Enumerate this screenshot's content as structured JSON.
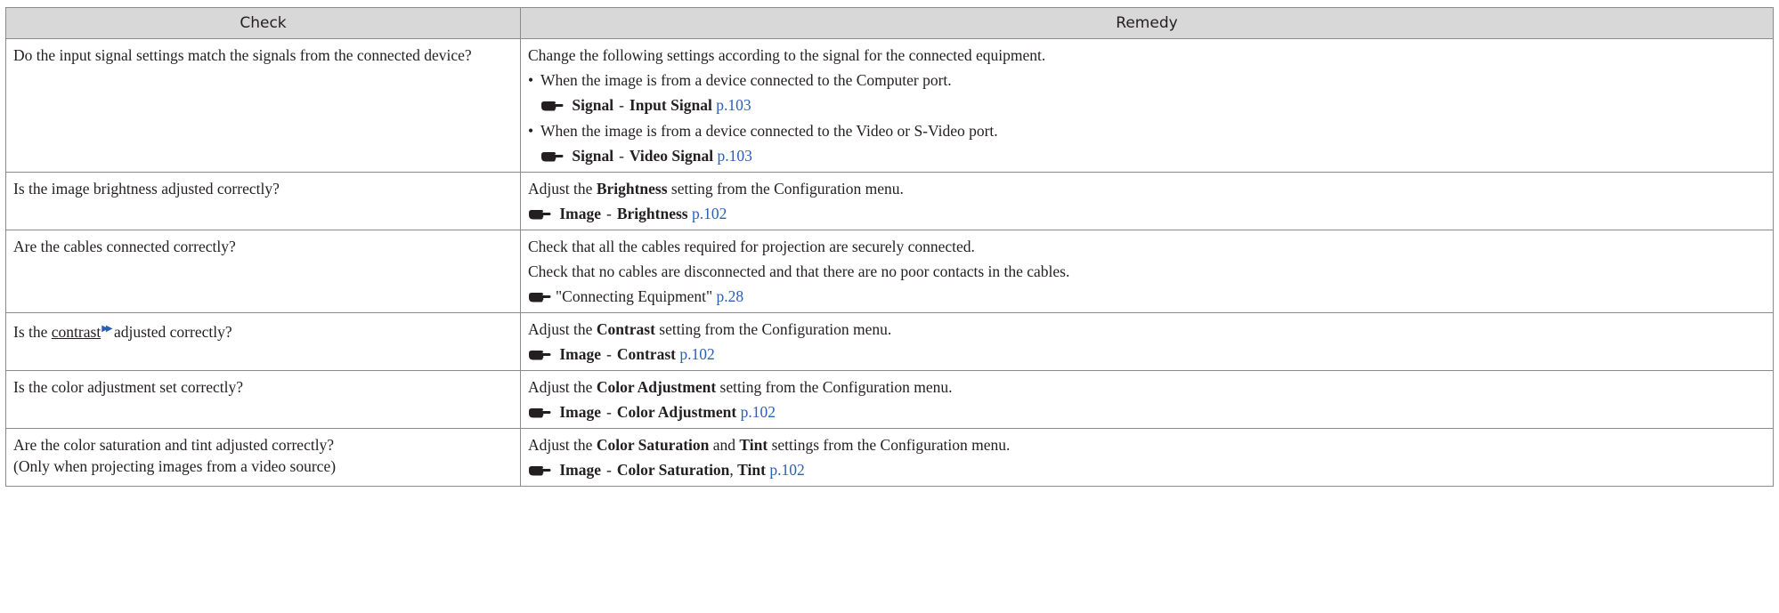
{
  "header": {
    "check": "Check",
    "remedy": "Remedy"
  },
  "rows": [
    {
      "check": "Do the input signal settings match the signals from the connected device?",
      "remedy_intro": "Change the following settings according to the signal for the connected equipment.",
      "bullet1": "When the image is from a device connected to the Computer port.",
      "ref1": {
        "menu": "Signal",
        "dash": "-",
        "item": "Input Signal",
        "page": "p.103"
      },
      "bullet2": "When the image is from a device connected to the Video or S-Video port.",
      "ref2": {
        "menu": "Signal",
        "dash": "-",
        "item": "Video Signal",
        "page": "p.103"
      }
    },
    {
      "check": "Is the image brightness adjusted correctly?",
      "pre": "Adjust the",
      "bold": "Brightness",
      "post": "setting from the Configuration menu.",
      "ref": {
        "menu": "Image",
        "dash": "-",
        "item": "Brightness",
        "page": "p.102"
      }
    },
    {
      "check": "Are the cables connected correctly?",
      "line1": "Check that all the cables required for projection are securely connected.",
      "line2": "Check that no cables are disconnected and that there are no poor contacts in the cables.",
      "ref": {
        "text": "\"Connecting Equipment\"",
        "page": "p.28"
      }
    },
    {
      "check_pre": "Is the",
      "check_term": "contrast",
      "check_post": "adjusted correctly?",
      "pre": "Adjust the",
      "bold": "Contrast",
      "post": "setting from the Configuration menu.",
      "ref": {
        "menu": "Image",
        "dash": "-",
        "item": "Contrast",
        "page": "p.102"
      }
    },
    {
      "check": "Is the color adjustment set correctly?",
      "pre": "Adjust the",
      "bold": "Color Adjustment",
      "post": "setting from the Configuration menu.",
      "ref": {
        "menu": "Image",
        "dash": "-",
        "item": "Color Adjustment",
        "page": "p.102"
      }
    },
    {
      "check_line1": "Are the color saturation and tint adjusted correctly?",
      "check_line2": "(Only when projecting images from a video source)",
      "pre": "Adjust the",
      "bold": "Color Saturation",
      "mid": "and",
      "bold2": "Tint",
      "post": "settings from the Configuration menu.",
      "ref": {
        "menu": "Image",
        "dash": "-",
        "item": "Color Saturation",
        "comma": ",",
        "item2": "Tint",
        "page": "p.102"
      }
    }
  ],
  "colors": {
    "header_bg": "#d8d8d8",
    "link": "#2a5fb5",
    "border": "#8a8a8a"
  },
  "icons": {
    "reference": "pointing-hand-icon",
    "glossary": "glossary-arrow-icon"
  }
}
